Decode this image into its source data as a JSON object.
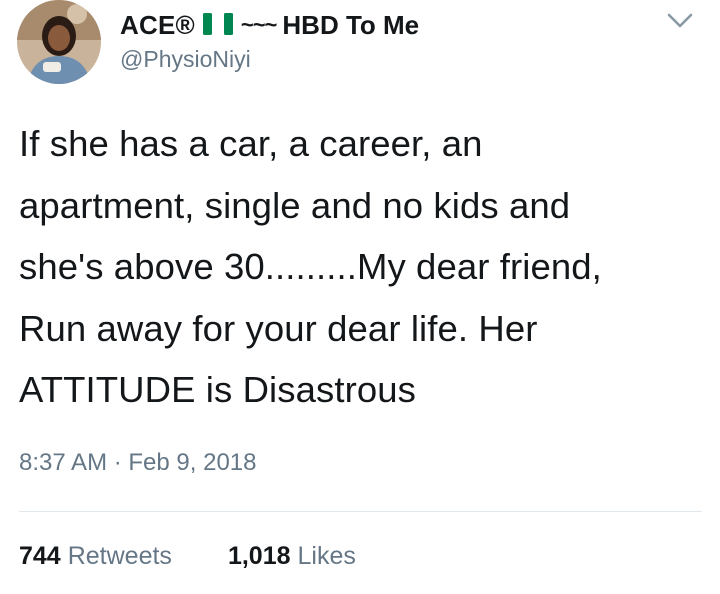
{
  "user": {
    "name": "ACE®",
    "flag_icon": "nigeria-flag-icon",
    "tilde": "~~~",
    "name_suffix": "HBD To Me",
    "handle": "@PhysioNiyi"
  },
  "tweet": {
    "lines": [
      "If she has a car, a career, an",
      "apartment, single and no kids and",
      "she's above 30.........My dear friend,",
      "Run away for your dear life. Her",
      "ATTITUDE is Disastrous"
    ],
    "timestamp": "8:37 AM · Feb 9, 2018"
  },
  "stats": {
    "retweets_count": "744",
    "retweets_label": "Retweets",
    "likes_count": "1,018",
    "likes_label": "Likes"
  },
  "colors": {
    "text": "#14171a",
    "secondary": "#657786",
    "flag_green": "#008751",
    "divider": "#e1e8ed"
  }
}
